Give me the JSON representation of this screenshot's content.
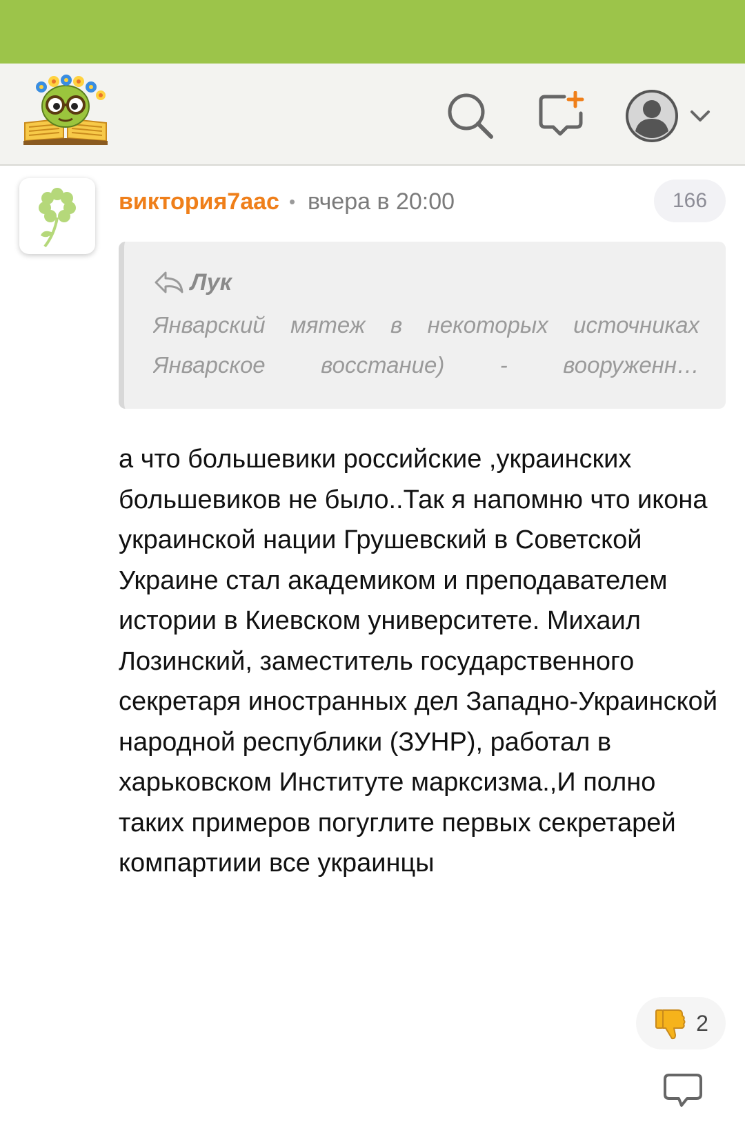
{
  "header": {
    "logo_icon": "bookworm-logo",
    "search_icon": "search-icon",
    "compose_icon": "new-message-icon",
    "profile_icon": "user-avatar-icon"
  },
  "comment": {
    "author": "виктория7аас",
    "separator": "•",
    "timestamp": "вчера в 20:00",
    "count": "166",
    "quote": {
      "author": "Лук",
      "text": "Январский мятеж в некоторых источниках Январское восстание) - вооруженн…"
    },
    "text": "а что большевики российские ,украинских большевиков не было..Так я напомню что икона украинской нации Грушевский в Советской Украине стал академиком и преподавателем истории в Киевском университете. Михаил Лозинский, заместитель государственного секретаря иностранных дел Западно-Украинской народной республики (ЗУНР), работал в харьковском Институте марксизма.,И полно таких примеров погуглите первых секретарей компартиии все украинцы",
    "dislikes": "2"
  },
  "colors": {
    "status_bar": "#9cc44a",
    "author": "#ef7f1a",
    "app_bar": "#f3f3f0"
  }
}
